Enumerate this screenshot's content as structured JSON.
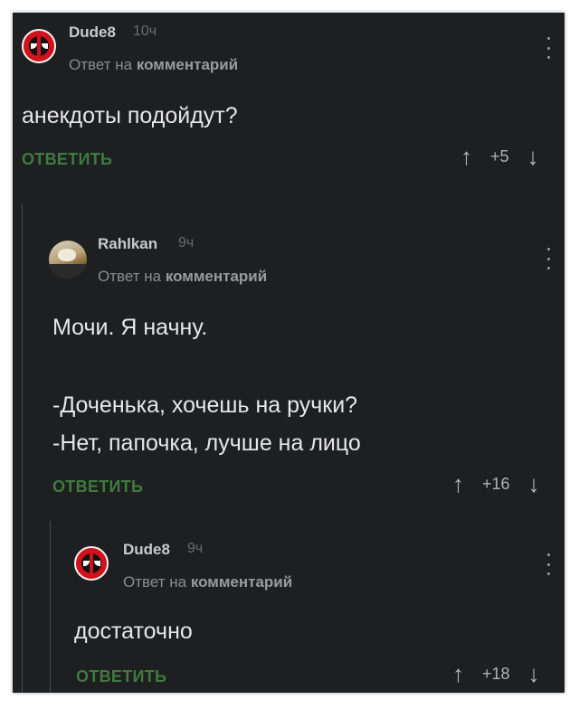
{
  "comments": [
    {
      "username": "Dude8",
      "time": "10ч",
      "reply_prefix": "Ответ на",
      "reply_target": "комментарий",
      "text": "анекдоты подойдут?",
      "reply_label": "ОТВЕТИТЬ",
      "score": "+5",
      "avatar": "deadpool-avatar"
    },
    {
      "username": "Rahlkan",
      "time": "9ч",
      "reply_prefix": "Ответ на",
      "reply_target": "комментарий",
      "text_lines": [
        "Мочи. Я начну.",
        "",
        "-Доченька, хочешь на ручки?",
        "-Нет, папочка, лучше на лицо"
      ],
      "reply_label": "ОТВЕТИТЬ",
      "score": "+16",
      "avatar": "photo-avatar"
    },
    {
      "username": "Dude8",
      "time": "9ч",
      "reply_prefix": "Ответ на",
      "reply_target": "комментарий",
      "text": "достаточно",
      "reply_label": "ОТВЕТИТЬ",
      "score": "+18",
      "avatar": "deadpool-avatar"
    }
  ],
  "icons": {
    "upvote": "↑",
    "downvote": "↓"
  },
  "colors": {
    "background": "#1e1f21",
    "reply_button": "#3f7a3f",
    "text": "#e7e7e8",
    "muted": "#8a8b8f"
  }
}
